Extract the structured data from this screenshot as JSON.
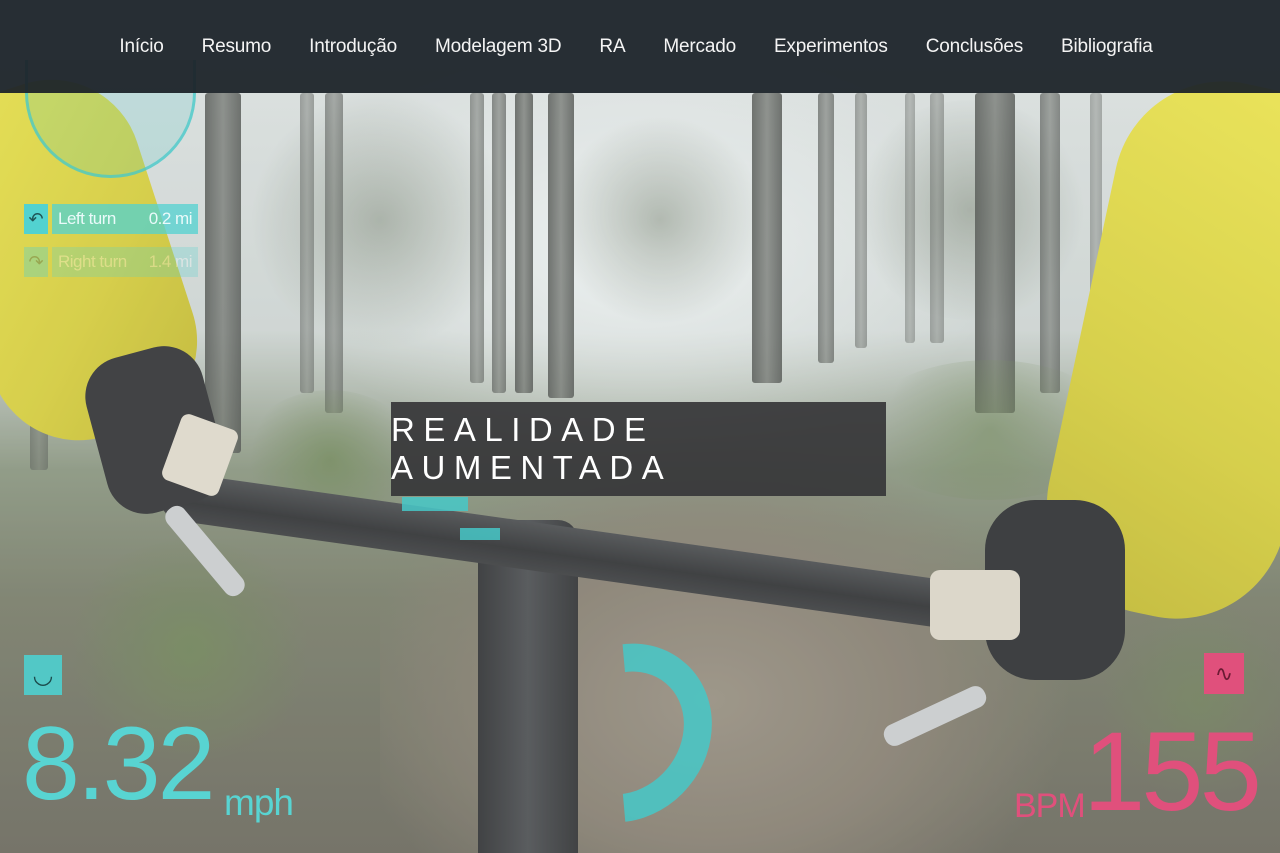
{
  "nav": {
    "items": [
      {
        "label": "Início"
      },
      {
        "label": "Resumo"
      },
      {
        "label": "Introdução"
      },
      {
        "label": "Modelagem 3D"
      },
      {
        "label": "RA"
      },
      {
        "label": "Mercado"
      },
      {
        "label": "Experimentos"
      },
      {
        "label": "Conclusões"
      },
      {
        "label": "Bibliografia"
      }
    ]
  },
  "hero": {
    "title": "REALIDADE AUMENTADA"
  },
  "hud": {
    "turn_primary": {
      "label": "Left turn",
      "distance": "0.2 mi",
      "icon": "left-turn-arrow-icon"
    },
    "turn_secondary": {
      "label": "Right turn",
      "distance": "1.4 mi",
      "icon": "right-turn-arrow-icon"
    },
    "speed": {
      "value": "8.32",
      "unit": "mph",
      "icon": "speedometer-icon"
    },
    "heart_rate": {
      "value": "155",
      "unit": "BPM",
      "icon": "heart-rate-icon"
    }
  },
  "colors": {
    "nav_background": "#1c2228",
    "hud_cyan": "#58d4d2",
    "hud_pink": "#e0507c",
    "title_box": "#373739"
  }
}
